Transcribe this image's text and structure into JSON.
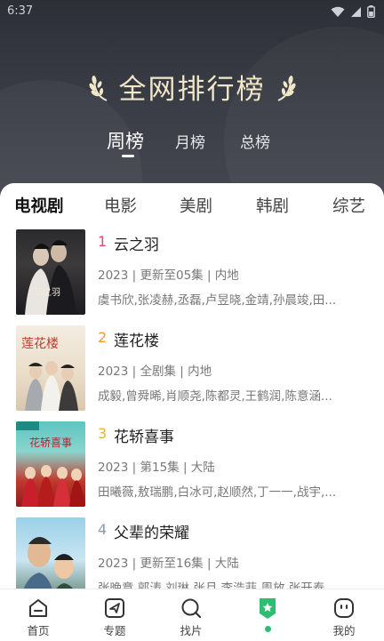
{
  "status_bar": {
    "time": "6:37"
  },
  "header": {
    "title": "全网排行榜",
    "period_tabs": [
      {
        "label": "周榜",
        "active": true
      },
      {
        "label": "月榜",
        "active": false
      },
      {
        "label": "总榜",
        "active": false
      }
    ]
  },
  "categories": [
    {
      "label": "电视剧",
      "active": true
    },
    {
      "label": "电影",
      "active": false
    },
    {
      "label": "美剧",
      "active": false
    },
    {
      "label": "韩剧",
      "active": false
    },
    {
      "label": "综艺",
      "active": false
    }
  ],
  "ranking": [
    {
      "rank": "1",
      "rank_color": "#e8457a",
      "title": "云之羽",
      "meta": "2023 | 更新至05集 | 内地",
      "cast": "虞书欣,张凌赫,丞磊,卢昱晓,金靖,孙晨竣,田...",
      "poster_text": "云之羽"
    },
    {
      "rank": "2",
      "rank_color": "#f29a2e",
      "title": "莲花楼",
      "meta": "2023 | 全剧集 | 内地",
      "cast": "成毅,曾舜晞,肖顺尧,陈都灵,王鹤润,陈意涵...",
      "poster_text": "莲花楼"
    },
    {
      "rank": "3",
      "rank_color": "#e7b531",
      "title": "花轿喜事",
      "meta": "2023 | 第15集 | 大陆",
      "cast": "田曦薇,敖瑞鹏,白冰可,赵顺然,丁一一,战宇,...",
      "poster_text": "花轿喜事"
    },
    {
      "rank": "4",
      "rank_color": "#8a9bb0",
      "title": "父辈的荣耀",
      "meta": "2023 | 更新至16集 | 大陆",
      "cast": "张晚意,郭涛,刘琳,张月,李浩菲,周放,张开泰,...",
      "poster_text": ""
    }
  ],
  "bottom_nav": [
    {
      "label": "首页",
      "icon": "home-icon"
    },
    {
      "label": "专题",
      "icon": "send-icon"
    },
    {
      "label": "找片",
      "icon": "search-icon"
    },
    {
      "label": "",
      "icon": "rank-badge-icon",
      "active": true
    },
    {
      "label": "我的",
      "icon": "profile-icon"
    }
  ],
  "colors": {
    "accent": "#2dbd73",
    "header_bg": "#33363d",
    "title_gold": "#f1e7c9"
  }
}
